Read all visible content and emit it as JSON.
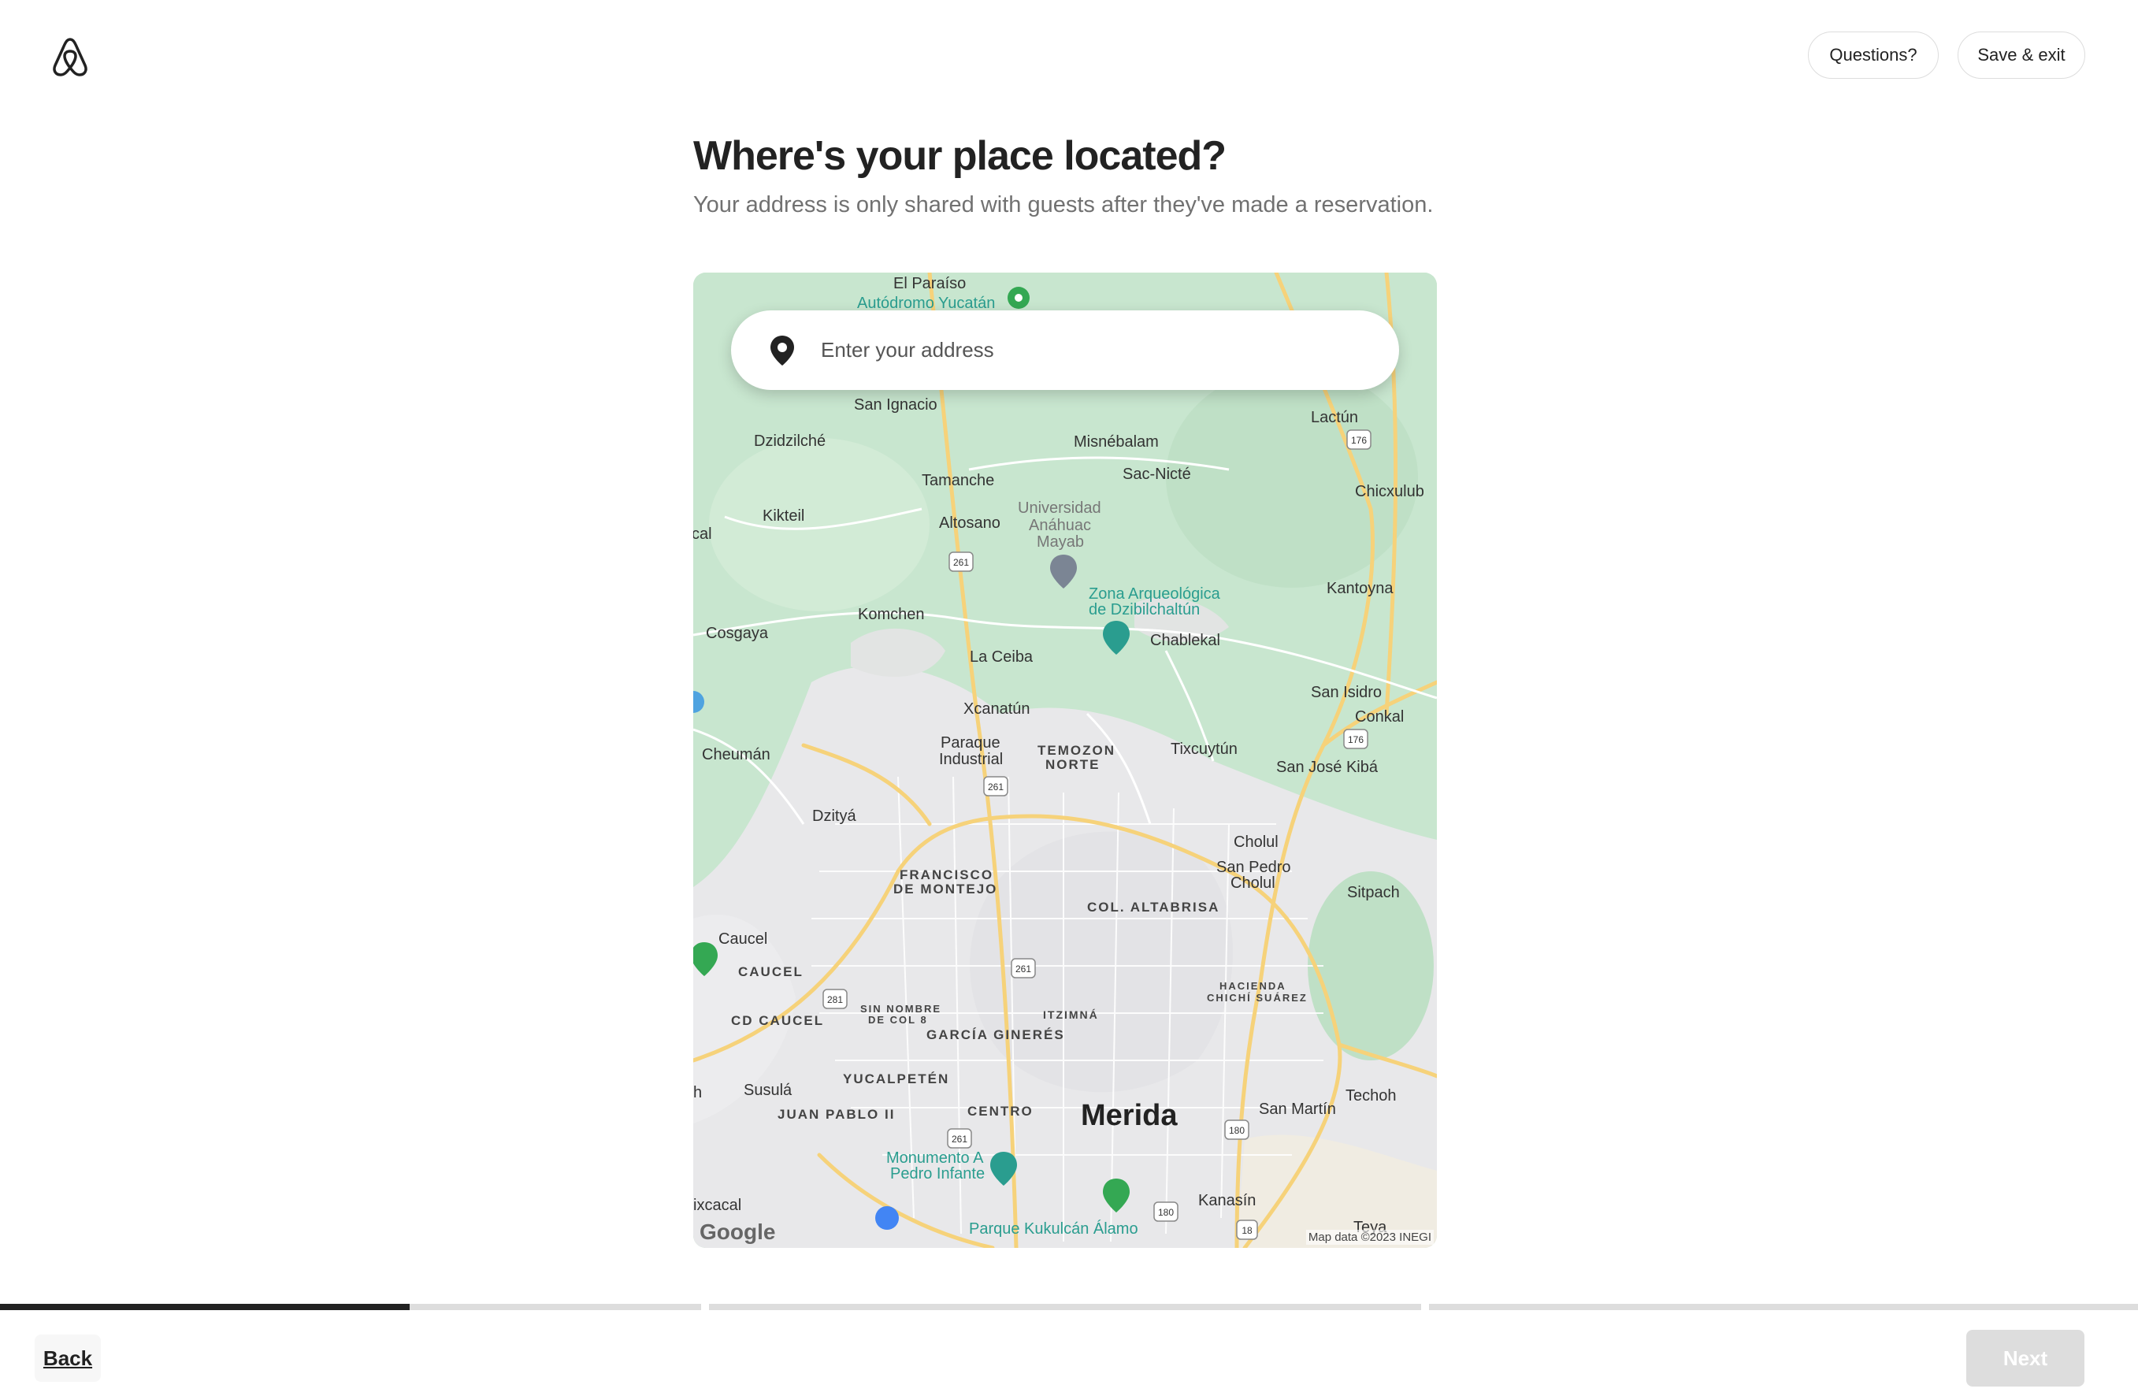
{
  "header": {
    "logo_icon": "airbnb-logo-icon",
    "questions_label": "Questions?",
    "save_exit_label": "Save & exit"
  },
  "main": {
    "title": "Where's your place located?",
    "subtitle": "Your address is only shared with guests after they've made a reservation."
  },
  "search": {
    "placeholder": "Enter your address",
    "icon": "location-pin-icon"
  },
  "map": {
    "attribution": "Map data ©2023 INEGI",
    "brand": "Google",
    "labels": {
      "el_paraiso": "El Paraíso",
      "autodromo": "Autódromo Yucatán",
      "san_ignacio": "San Ignacio",
      "lactun": "Lactún",
      "dzidzilche": "Dzidzilché",
      "misnebalam": "Misnébalam",
      "sac_nicte": "Sac-Nicté",
      "tamanche": "Tamanche",
      "chicxulub": "Chicxulub",
      "kikteil": "Kikteil",
      "altosano": "Altosano",
      "universidad1": "Universidad",
      "universidad2": "Anáhuac",
      "universidad3": "Mayab",
      "cal": "cal",
      "zona1": "Zona Arqueológica",
      "zona2": "de Dzibilchaltún",
      "kantoyna": "Kantoyna",
      "cosgaya": "Cosgaya",
      "komchen": "Komchen",
      "chablekal": "Chablekal",
      "la_ceiba": "La Ceiba",
      "san_isidro": "San Isidro",
      "xcanatun": "Xcanatún",
      "conkal": "Conkal",
      "cheuman": "Cheumán",
      "paraque1": "Paraque",
      "paraque2": "Industrial",
      "temozon1": "TEMOZON",
      "temozon2": "NORTE",
      "tixcuytun": "Tixcuytún",
      "san_jose_kiba": "San José Kibá",
      "dzitya": "Dzityá",
      "cholul": "Cholul",
      "francisco1": "FRANCISCO",
      "francisco2": "DE MONTEJO",
      "san_pedro1": "San Pedro",
      "san_pedro2": "Cholul",
      "sitpach": "Sitpach",
      "col_altabrisa": "COL. ALTABRISA",
      "caucel": "Caucel",
      "caucel_caps": "CAUCEL",
      "hacienda1": "HACIENDA",
      "hacienda2": "CHICHÍ SUÁREZ",
      "sin_nombre1": "SIN NOMBRE",
      "sin_nombre2": "DE COL 8",
      "cd_caucel": "CD CAUCEL",
      "itzimna": "ITZIMNÁ",
      "garcia_gineres": "GARCÍA GINERÉS",
      "yucalpeten": "YUCALPETÉN",
      "techoh": "Techoh",
      "h": "h",
      "susula": "Susulá",
      "merida": "Merida",
      "san_martin": "San Martín",
      "juan_pablo": "JUAN PABLO II",
      "centro": "CENTRO",
      "monumento1": "Monumento A",
      "monumento2": "Pedro Infante",
      "kanasin": "Kanasín",
      "ixcacal": "ixcacal",
      "parque_kukulcan": "Parque Kukulcán Álamo",
      "teya": "Teya",
      "r176a": "176",
      "r176b": "176",
      "r261a": "261",
      "r261b": "261",
      "r261c": "261",
      "r261d": "261",
      "r281": "281",
      "r180a": "180",
      "r180b": "180",
      "r18": "18"
    }
  },
  "footer": {
    "back_label": "Back",
    "next_label": "Next",
    "progress_steps": [
      0.6,
      0,
      0
    ]
  }
}
